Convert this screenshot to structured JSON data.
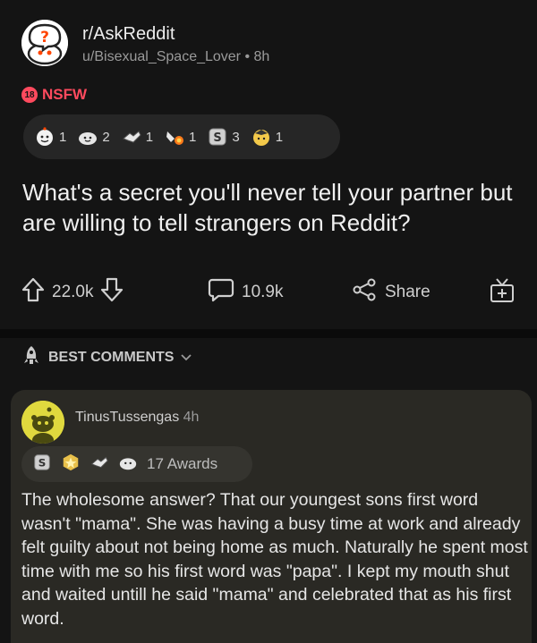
{
  "post": {
    "subreddit": "r/AskReddit",
    "author": "u/Bisexual_Space_Lover",
    "separator": "•",
    "age": "8h",
    "nsfw_badge": "18",
    "nsfw_label": "NSFW",
    "awards": [
      {
        "icon": "wholesome-award-icon",
        "count": "1"
      },
      {
        "icon": "helpful-award-icon",
        "count": "2"
      },
      {
        "icon": "hug-award-icon",
        "count": "1"
      },
      {
        "icon": "fist-bump-award-icon",
        "count": "1"
      },
      {
        "icon": "silver-award-icon",
        "count": "3"
      },
      {
        "icon": "take-my-energy-award-icon",
        "count": "1"
      }
    ],
    "title": "What's a secret you'll never tell your partner but are willing to tell strangers on Reddit?",
    "upvotes": "22.0k",
    "comments": "10.9k",
    "share_label": "Share"
  },
  "sort": {
    "label": "BEST COMMENTS"
  },
  "comment": {
    "author": "TinusTussengas",
    "age": "4h",
    "awards_label": "17 Awards",
    "body": "The wholesome answer? That our youngest sons first word wasn't \"mama\". She was having a busy time at work and already felt guilty about not being home as much. Naturally he spent most time with me so his first word was \"papa\". I kept my mouth shut and waited untill he said \"mama\" and celebrated that as his first word."
  },
  "colors": {
    "background": "#141414",
    "accent": "#ff4a5e",
    "comment_bg": "#2a2924"
  }
}
